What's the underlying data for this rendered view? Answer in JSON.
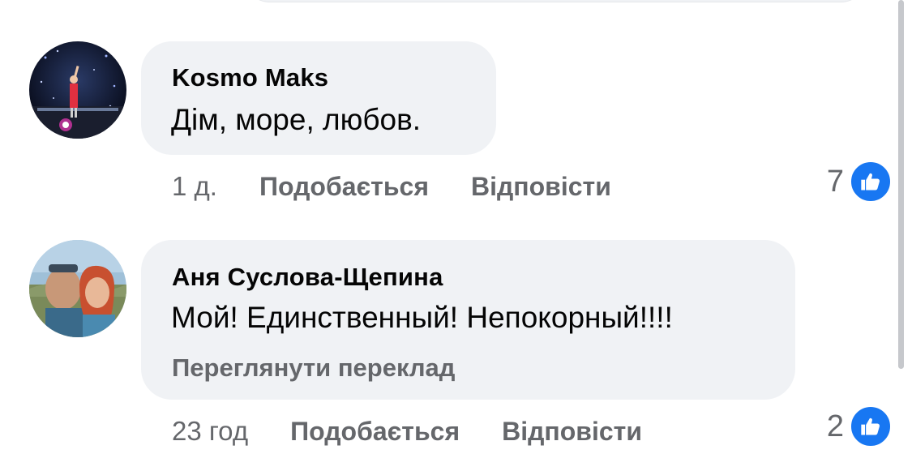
{
  "comments": [
    {
      "author": "Kosmo Maks",
      "text": "Дім, море, любов.",
      "time": "1 д.",
      "like_label": "Подобається",
      "reply_label": "Відповісти",
      "reaction_count": "7"
    },
    {
      "author": "Аня Суслова-Щепина",
      "text": "Мой! Единственный! Непокорный!!!!",
      "translate_label": "Переглянути переклад",
      "time": "23 год",
      "like_label": "Подобається",
      "reply_label": "Відповісти",
      "reaction_count": "2"
    }
  ],
  "colors": {
    "bubble": "#f0f2f5",
    "like_blue": "#1877f2",
    "secondary_text": "#65676b",
    "primary_text": "#050505"
  },
  "icons": [
    "like-thumb-icon"
  ]
}
